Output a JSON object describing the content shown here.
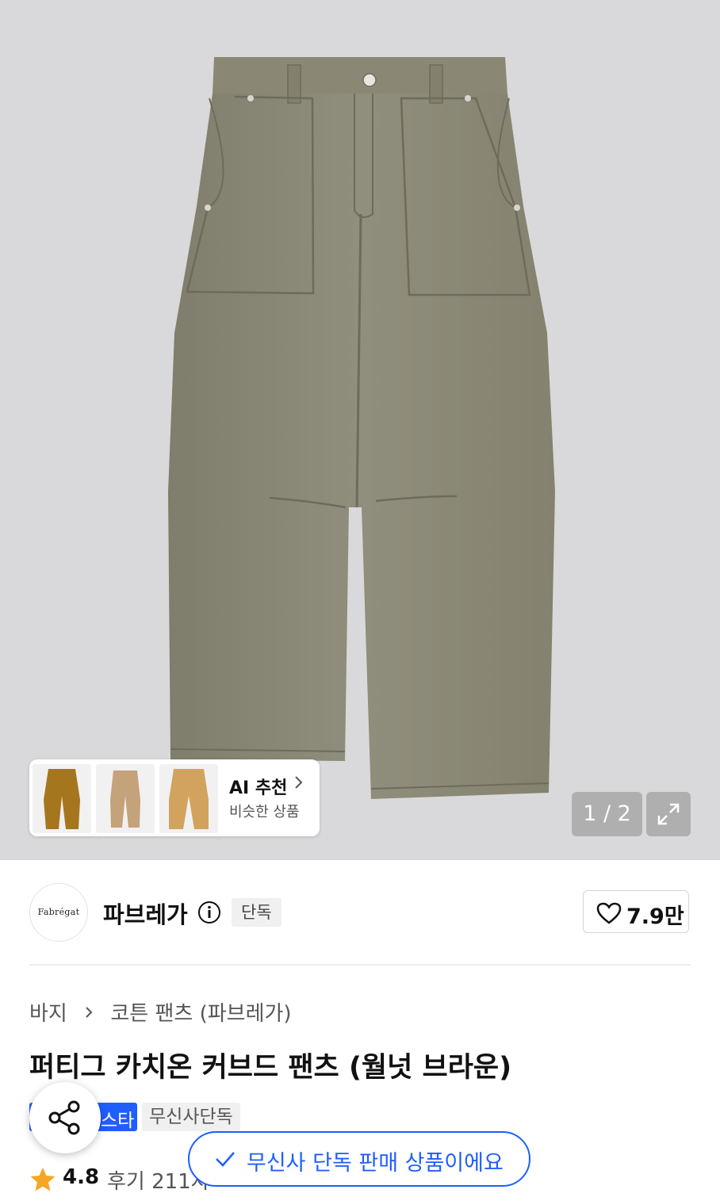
{
  "gallery": {
    "counter": "1 / 2",
    "ai_card": {
      "title": "AI 추천",
      "subtitle": "비슷한 상품"
    }
  },
  "brand": {
    "logo_text": "Fabrégat",
    "name": "파브레가",
    "badge": "단독",
    "like_count": "7.9만"
  },
  "breadcrumb": [
    "바지",
    "코튼 팬츠 (파브레가)"
  ],
  "product": {
    "title": "퍼티그 카치온 커브드 팬츠 (월넛 브라운)",
    "tags": {
      "star": "스타",
      "exclusive": "무신사단독"
    },
    "rating": "4.8",
    "review_text": "후기 211자"
  },
  "toast": {
    "text": "무신사 단독 판매 상품이에요"
  },
  "colors": {
    "accent": "#1f5eff",
    "pants": "#8c8a77",
    "background": "#d9d9db"
  },
  "icons": [
    "info-icon",
    "chevron-right-icon",
    "expand-icon",
    "heart-icon",
    "share-icon",
    "check-icon",
    "star-icon"
  ]
}
